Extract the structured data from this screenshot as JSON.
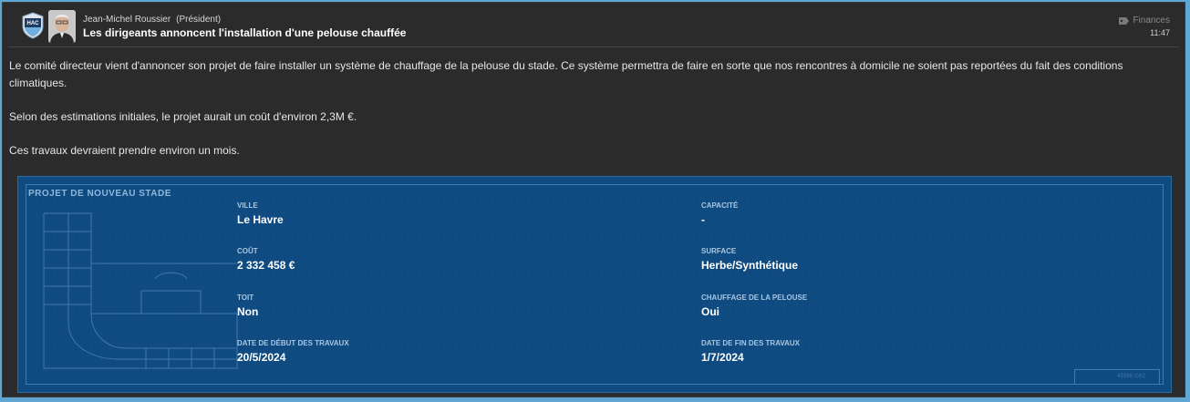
{
  "message": {
    "sender_name": "Jean-Michel Roussier",
    "sender_role": "(Président)",
    "subject": "Les dirigeants annoncent l'installation d'une pelouse chauffée",
    "category": "Finances",
    "time": "11:47",
    "crest_text": "HAC"
  },
  "body": {
    "paragraphs": [
      "Le comité directeur vient d'annoncer son projet de faire installer un système de chauffage de la pelouse du stade. Ce système permettra de faire en sorte que nos rencontres à domicile ne soient pas reportées du fait des conditions climatiques.",
      "Selon des estimations initiales, le projet aurait un coût d'environ 2,3M €.",
      "Ces travaux devraient prendre environ un mois."
    ]
  },
  "stadium_project": {
    "title": "PROJET DE NOUVEAU STADE",
    "fields": [
      {
        "label": "VILLE",
        "value": "Le Havre"
      },
      {
        "label": "CAPACITÉ",
        "value": "-"
      },
      {
        "label": "COÛT",
        "value": "2 332 458 €"
      },
      {
        "label": "SURFACE",
        "value": "Herbe/Synthétique"
      },
      {
        "label": "TOIT",
        "value": "Non"
      },
      {
        "label": "CHAUFFAGE DE LA PELOUSE",
        "value": "Oui"
      },
      {
        "label": "DATE DE DÉBUT DES TRAVAUX",
        "value": "20/5/2024"
      },
      {
        "label": "DATE DE FIN DES TRAVAUX",
        "value": "1/7/2024"
      }
    ],
    "ref_code": "45586 /0X2"
  },
  "icons": {
    "crest": "club-crest-icon",
    "avatar": "president-avatar",
    "category": "tag-icon"
  },
  "colors": {
    "background": "#2b2b2b",
    "panel": "#0f4b80",
    "accent": "#5fa6d4"
  }
}
